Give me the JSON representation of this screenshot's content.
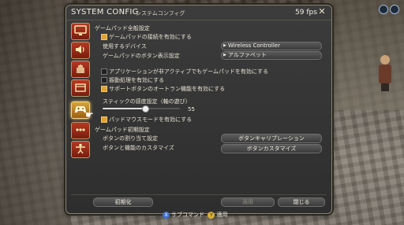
{
  "window": {
    "title": "SYSTEM CONFIG",
    "subtitle": "システムコンフィグ",
    "fps": "59 fps"
  },
  "sidebar": {
    "tabs": [
      {
        "icon": "monitor-icon"
      },
      {
        "icon": "speaker-icon"
      },
      {
        "icon": "hand-icon"
      },
      {
        "icon": "box-icon"
      },
      {
        "icon": "gamepad-icon",
        "active": true
      },
      {
        "icon": "dots-icon"
      },
      {
        "icon": "person-icon"
      }
    ]
  },
  "settings": {
    "section_general": "ゲームパッド全般設定",
    "enable_gamepad": {
      "label": "ゲームパッドの接続を有効にする",
      "checked": true
    },
    "device": {
      "label": "使用するデバイス",
      "value": "Wireless Controller"
    },
    "button_display": {
      "label": "ゲームパッドのボタン表示設定",
      "value": "アルファベット"
    },
    "inactive_gamepad": {
      "label": "アプリケーションが非アクティブでもゲームパッドを有効にする",
      "checked": false
    },
    "vibration": {
      "label": "振動処理を有効にする",
      "checked": false
    },
    "autorun": {
      "label": "サポートボタンのオートラン機能を有効にする",
      "checked": true
    },
    "stick_sensitivity": {
      "label": "スティックの感度設定（軸の遊び）",
      "value": "55",
      "fraction": 0.55
    },
    "pad_mouse": {
      "label": "パッドマウスモードを有効にする",
      "checked": true
    },
    "section_init": "ゲームパッド初期設定",
    "button_assign": {
      "label": "ボタンの割り当て設定",
      "button": "ボタンキャリブレーション"
    },
    "button_custom": {
      "label": "ボタンと機能のカスタマイズ",
      "button": "ボタンカスタマイズ"
    }
  },
  "footer": {
    "reset": "初期化",
    "apply": "適用",
    "close": "閉じる"
  },
  "hints": {
    "subcommand_key": "X",
    "subcommand": "サブコマンド",
    "apply_key": "Y",
    "apply": "適用"
  },
  "colors": {
    "accent": "#e0a12e",
    "tab_red": "#b33a22",
    "tab_active": "#d9a43a"
  }
}
